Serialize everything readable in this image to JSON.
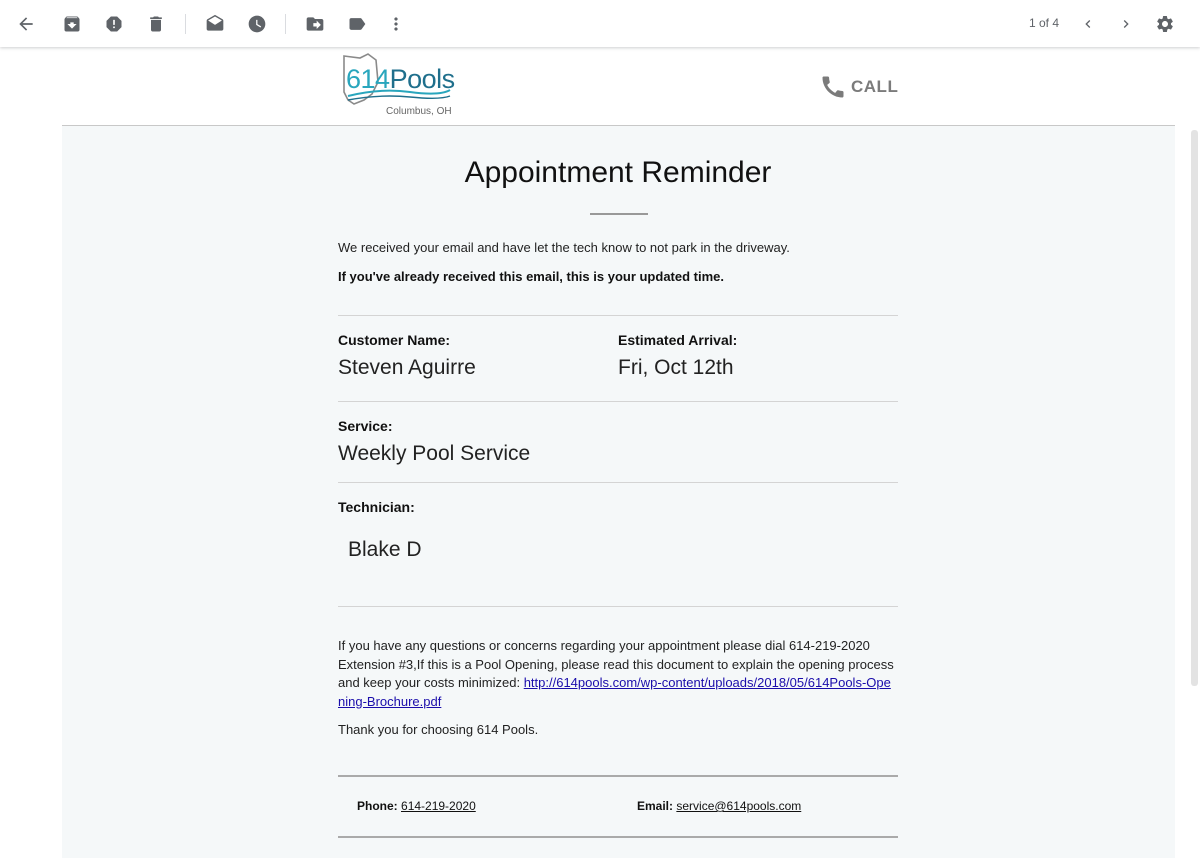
{
  "toolbar": {
    "pager": "1 of 4",
    "icons": [
      "back-icon",
      "archive-icon",
      "report-spam-icon",
      "delete-icon",
      "mark-unread-icon",
      "snooze-icon",
      "move-to-icon",
      "labels-icon",
      "more-icon",
      "prev-icon",
      "next-icon",
      "settings-icon"
    ]
  },
  "brand": {
    "logo_main": "614",
    "logo_accent": "Pools",
    "logo_city": "Columbus, OH",
    "call_label": "CALL"
  },
  "email": {
    "title": "Appointment Reminder",
    "intro": "We received your email and have let the tech know to not park in the driveway.",
    "notice": "If you've already received this email, this is your updated time.",
    "customer_label": "Customer Name:",
    "customer_value": "Steven Aguirre",
    "arrival_label": "Estimated Arrival:",
    "arrival_value": "Fri, Oct 12th",
    "service_label": "Service:",
    "service_value": "Weekly Pool Service",
    "tech_label": "Technician:",
    "tech_value": "Blake D",
    "questions_text": "If you have any questions or concerns regarding your appointment please dial 614-219-2020 Extension #3,If this is a Pool Opening, please read this document to explain the opening process and keep your costs minimized: ",
    "brochure_link": "http://614pools.com/wp-content/uploads/2018/05/614Pools-Opening-Brochure.pdf",
    "thanks": "Thank you for choosing 614 Pools.",
    "phone_label": "Phone:",
    "phone_value": "614-219-2020",
    "email_label": "Email:",
    "email_value": "service@614pools.com"
  }
}
